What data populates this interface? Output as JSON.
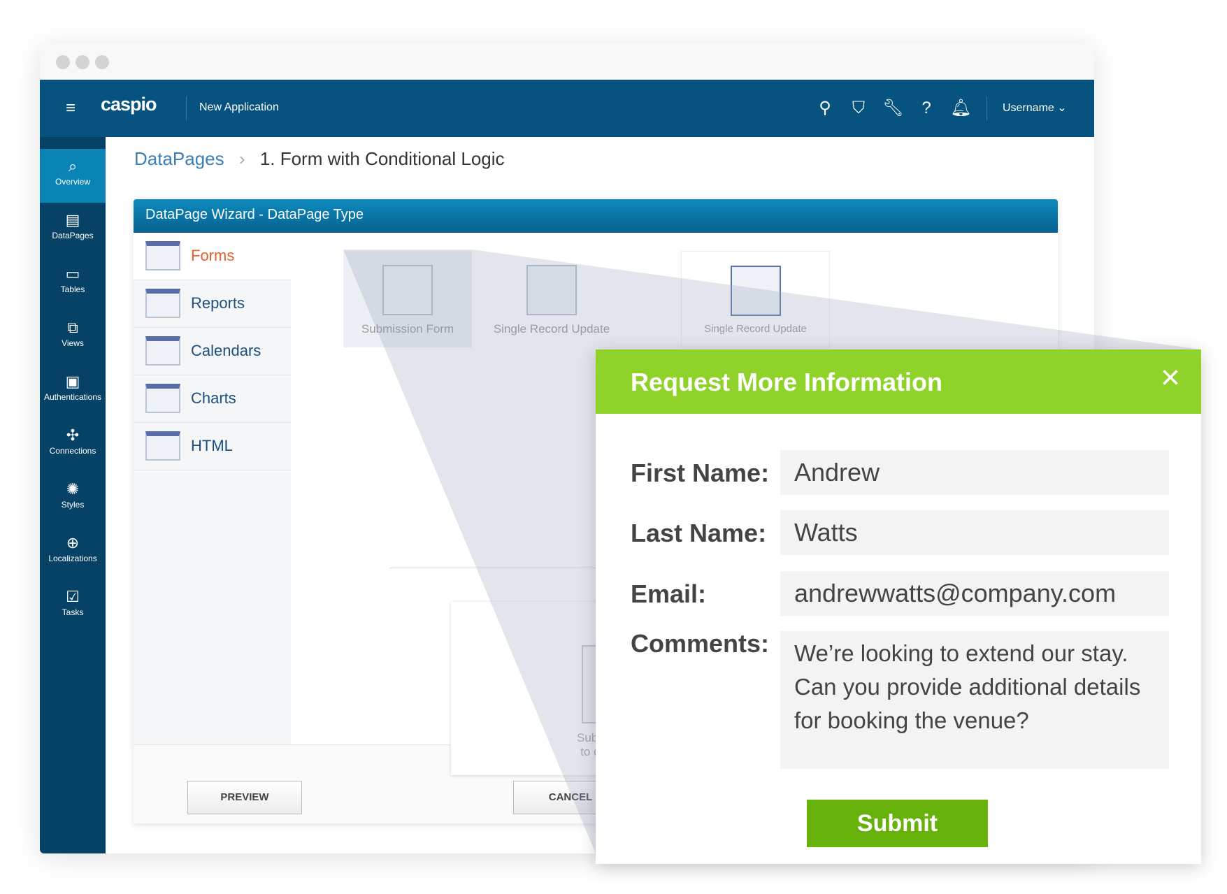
{
  "header": {
    "app_name": "New Application",
    "logo": "caspio",
    "username": "Username",
    "icons": [
      "menu-icon",
      "search-icon",
      "shield-icon",
      "wrench-icon",
      "help-icon",
      "bell-icon"
    ]
  },
  "sidebar": {
    "items": [
      {
        "label": "Overview",
        "icon": "overview-icon",
        "glyph": "⌕",
        "active": true
      },
      {
        "label": "DataPages",
        "icon": "datapages-icon",
        "glyph": "▤"
      },
      {
        "label": "Tables",
        "icon": "tables-icon",
        "glyph": "▭"
      },
      {
        "label": "Views",
        "icon": "views-icon",
        "glyph": "⧉"
      },
      {
        "label": "Authentications",
        "icon": "authentications-icon",
        "glyph": "▣"
      },
      {
        "label": "Connections",
        "icon": "connections-icon",
        "glyph": "✣"
      },
      {
        "label": "Styles",
        "icon": "styles-icon",
        "glyph": "✺"
      },
      {
        "label": "Localizations",
        "icon": "globe-icon",
        "glyph": "⊕"
      },
      {
        "label": "Tasks",
        "icon": "tasks-icon",
        "glyph": "☑"
      }
    ]
  },
  "breadcrumb": {
    "parent": "DataPages",
    "separator": "›",
    "current": "1. Form with Conditional Logic"
  },
  "wizard": {
    "title": "DataPage Wizard - DataPage Type",
    "types": [
      {
        "label": "Forms",
        "selected": true
      },
      {
        "label": "Reports"
      },
      {
        "label": "Calendars"
      },
      {
        "label": "Charts"
      },
      {
        "label": "HTML"
      }
    ],
    "options": [
      "Submission Form",
      "Single Record Update",
      "Single Record Update"
    ],
    "preview_caption": [
      "Submit",
      "to dat"
    ],
    "preview_label": "PREVIEW",
    "cancel_label": "CANCEL"
  },
  "modal": {
    "title": "Request More Information",
    "close": "×",
    "fields": [
      {
        "label": "First Name:",
        "value": "Andrew"
      },
      {
        "label": "Last Name:",
        "value": "Watts"
      },
      {
        "label": "Email:",
        "value": "andrewwatts@company.com"
      },
      {
        "label": "Comments:",
        "lines": [
          "We’re looking to extend our stay.",
          "Can you provide additional details",
          "for booking the venue?"
        ]
      }
    ],
    "submit_label": "Submit"
  },
  "colors": {
    "header": "#05537e",
    "sidebar": "#064266",
    "accent_green": "#8fd22a",
    "submit": "#66b10a",
    "forms_orange": "#e0632a"
  }
}
